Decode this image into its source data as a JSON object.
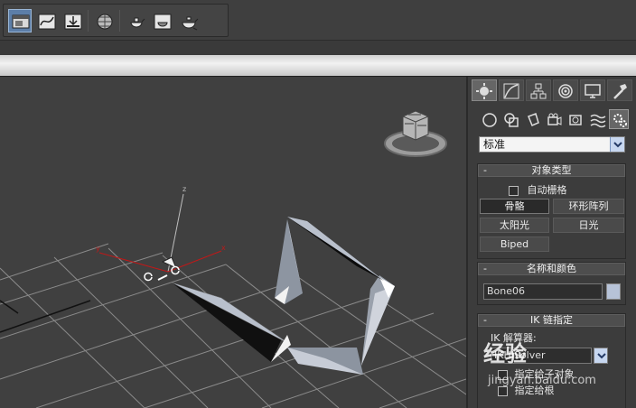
{
  "toolbar": {
    "buttons": [
      "scene-explorer",
      "curve-editor",
      "render-setup",
      "material-editor",
      "render-frame",
      "render-production",
      "render-iterative"
    ]
  },
  "command_panel": {
    "tabs": [
      "create",
      "modify",
      "hierarchy",
      "motion",
      "display",
      "utilities"
    ],
    "subcategories": [
      "geometry",
      "shapes",
      "lights",
      "cameras",
      "helpers",
      "space-warps",
      "systems"
    ],
    "category_dropdown": {
      "selected": "标准"
    },
    "object_type": {
      "title": "对象类型",
      "autogrid_label": "自动栅格",
      "buttons": [
        {
          "label": "骨骼",
          "active": true
        },
        {
          "label": "环形阵列",
          "active": false
        },
        {
          "label": "太阳光",
          "active": false
        },
        {
          "label": "日光",
          "active": false
        },
        {
          "label": "Biped",
          "active": false
        }
      ]
    },
    "name_color": {
      "title": "名称和颜色",
      "name_value": "Bone06",
      "color": "#b7c3d8"
    },
    "ik_chain": {
      "title": "IK 链指定",
      "solver_label": "IK 解算器:",
      "solver_value": "IKHISolver",
      "assign_children_label": "指定给子对象",
      "assign_root_label": "指定给根"
    }
  },
  "watermark": {
    "brand": "经验",
    "url": "jingyan.baidu.com"
  },
  "colors": {
    "accent": "#5c7ea8",
    "viewport_bg": "#404040",
    "bone": "#b9c0cc"
  }
}
